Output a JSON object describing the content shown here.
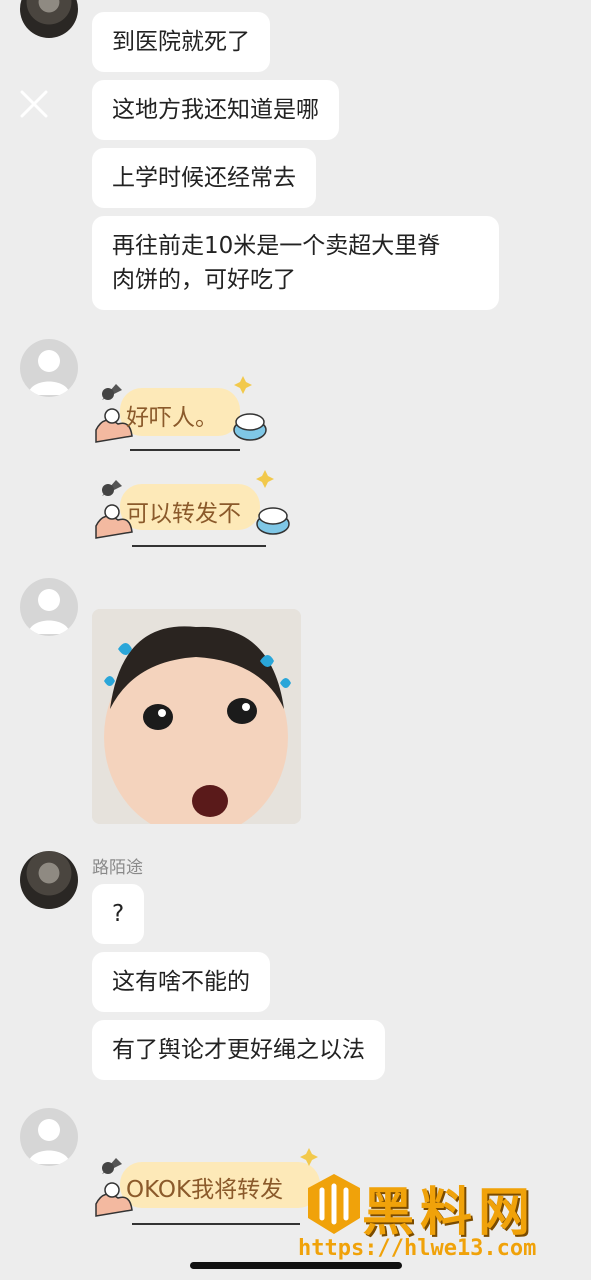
{
  "top_sender": {
    "name": "路陌途"
  },
  "messages_group1": [
    "到医院就死了",
    "这地方我还知道是哪",
    "上学时候还经常去",
    "再往前走10米是一个卖超大里脊",
    "肉饼的，可好吃了"
  ],
  "stickers_group2": [
    "好吓人。",
    "可以转发不"
  ],
  "group4": {
    "sender": "路陌途",
    "messages": [
      "?",
      "这有啥不能的",
      "有了舆论才更好绳之以法"
    ]
  },
  "sticker_group5": "OKOK我将转发",
  "watermark": {
    "title": "黑料网",
    "url": "https://hlwe13.com"
  },
  "colors": {
    "background": "#ededed",
    "bubble": "#ffffff",
    "sticker_text": "#8b5a2b",
    "watermark": "#f0a20a"
  }
}
